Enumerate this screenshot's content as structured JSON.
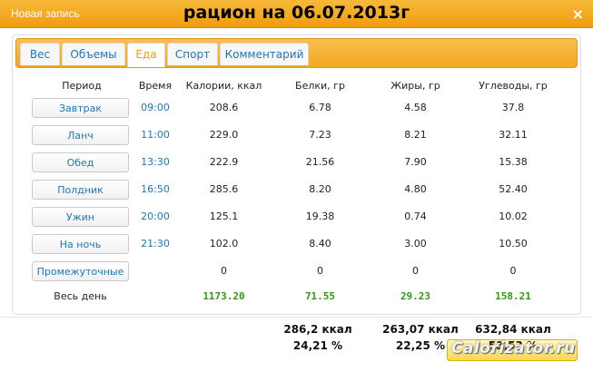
{
  "window": {
    "title": "Новая запись",
    "date_title": "рацион на 06.07.2013г",
    "close_symbol": "×"
  },
  "tabs": [
    {
      "label": "Вес"
    },
    {
      "label": "Объемы"
    },
    {
      "label": "Еда"
    },
    {
      "label": "Спорт"
    },
    {
      "label": "Комментарий"
    }
  ],
  "active_tab": "Еда",
  "table": {
    "headers": {
      "period": "Период",
      "time": "Время",
      "calories": "Калории, ккал",
      "protein": "Белки, гр",
      "fat": "Жиры, гр",
      "carbs": "Углеводы, гр"
    },
    "rows": [
      {
        "period": "Завтрак",
        "time": "09:00",
        "calories": "208.6",
        "protein": "6.78",
        "fat": "4.58",
        "carbs": "37.8"
      },
      {
        "period": "Ланч",
        "time": "11:00",
        "calories": "229.0",
        "protein": "7.23",
        "fat": "8.21",
        "carbs": "32.11"
      },
      {
        "period": "Обед",
        "time": "13:30",
        "calories": "222.9",
        "protein": "21.56",
        "fat": "7.90",
        "carbs": "15.38"
      },
      {
        "period": "Полдник",
        "time": "16:50",
        "calories": "285.6",
        "protein": "8.20",
        "fat": "4.80",
        "carbs": "52.40"
      },
      {
        "period": "Ужин",
        "time": "20:00",
        "calories": "125.1",
        "protein": "19.38",
        "fat": "0.74",
        "carbs": "10.02"
      },
      {
        "period": "На ночь",
        "time": "21:30",
        "calories": "102.0",
        "protein": "8.40",
        "fat": "3.00",
        "carbs": "10.50"
      },
      {
        "period": "Промежуточные",
        "time": "",
        "calories": "0",
        "protein": "0",
        "fat": "0",
        "carbs": "0"
      }
    ],
    "total": {
      "label": "Весь день",
      "calories": "1173.20",
      "protein": "71.55",
      "fat": "29.23",
      "carbs": "158.21"
    }
  },
  "summary": {
    "protein_kcal": "286,2 ккал",
    "protein_pct": "24,21 %",
    "fat_kcal": "263,07 ккал",
    "fat_pct": "22,25 %",
    "carbs_kcal": "632,84 ккал",
    "carbs_pct": "53,53 %"
  },
  "watermark": "Calorizator.ru",
  "colors": {
    "accent": "#f19c0d",
    "link": "#1b78b7",
    "total_green": "#2f9a10"
  }
}
